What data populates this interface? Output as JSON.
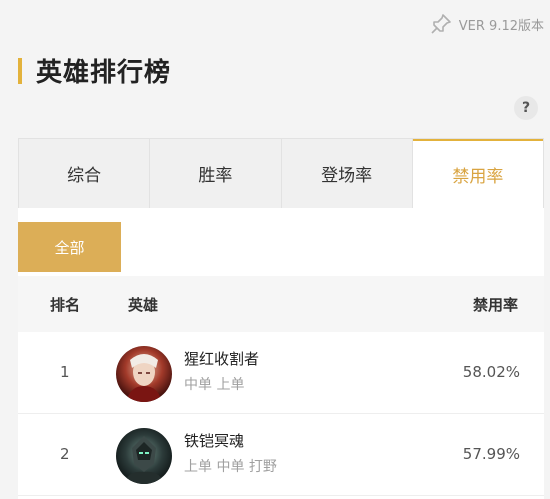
{
  "header": {
    "version": "VER 9.12版本",
    "title": "英雄排行榜",
    "help": "?"
  },
  "tabs": [
    {
      "label": "综合",
      "active": false
    },
    {
      "label": "胜率",
      "active": false
    },
    {
      "label": "登场率",
      "active": false
    },
    {
      "label": "禁用率",
      "active": true
    }
  ],
  "filter": {
    "label": "全部"
  },
  "table": {
    "headers": {
      "rank": "排名",
      "hero": "英雄",
      "rate": "禁用率"
    },
    "rows": [
      {
        "rank": "1",
        "name": "猩红收割者",
        "roles": "中单 上单",
        "rate": "58.02%",
        "avatar_icon": "vladimir-portrait"
      },
      {
        "rank": "2",
        "name": "铁铠冥魂",
        "roles": "上单 中单 打野",
        "rate": "57.99%",
        "avatar_icon": "mordekaiser-portrait"
      }
    ]
  },
  "colors": {
    "accent": "#e3b23c",
    "active_tab_text": "#d9a441",
    "filter_bg": "#dcae57"
  }
}
